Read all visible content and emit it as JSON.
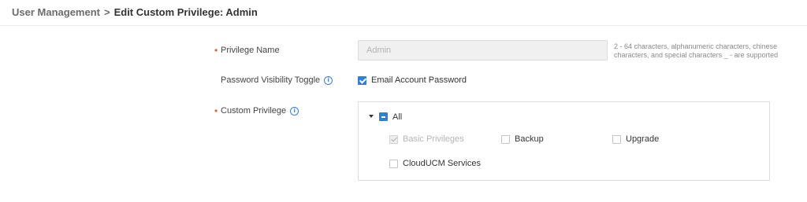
{
  "breadcrumb": {
    "parent": "User Management",
    "separator": ">",
    "current": "Edit Custom Privilege: Admin"
  },
  "form": {
    "privilege_name": {
      "label": "Privilege Name",
      "required_mark": "•",
      "value": "Admin",
      "hint": "2 - 64 characters, alphanumeric characters, chinese characters, and special characters _ - are supported"
    },
    "password_visibility": {
      "label": "Password Visibility Toggle",
      "info_icon": "info-icon",
      "option_label": "Email Account Password",
      "checked": true
    },
    "custom_privilege": {
      "label": "Custom Privilege",
      "required_mark": "•",
      "info_icon": "info-icon",
      "tree": {
        "root_label": "All",
        "root_state": "indeterminate",
        "expanded": true,
        "items": [
          {
            "label": "Basic Privileges",
            "checked": true,
            "disabled": true
          },
          {
            "label": "Backup",
            "checked": false,
            "disabled": false
          },
          {
            "label": "Upgrade",
            "checked": false,
            "disabled": false
          },
          {
            "label": "CloudUCM Services",
            "checked": false,
            "disabled": false
          }
        ]
      }
    }
  },
  "colors": {
    "accent": "#2f7fd8",
    "required": "#e0603a",
    "info": "#3d7fd6"
  }
}
